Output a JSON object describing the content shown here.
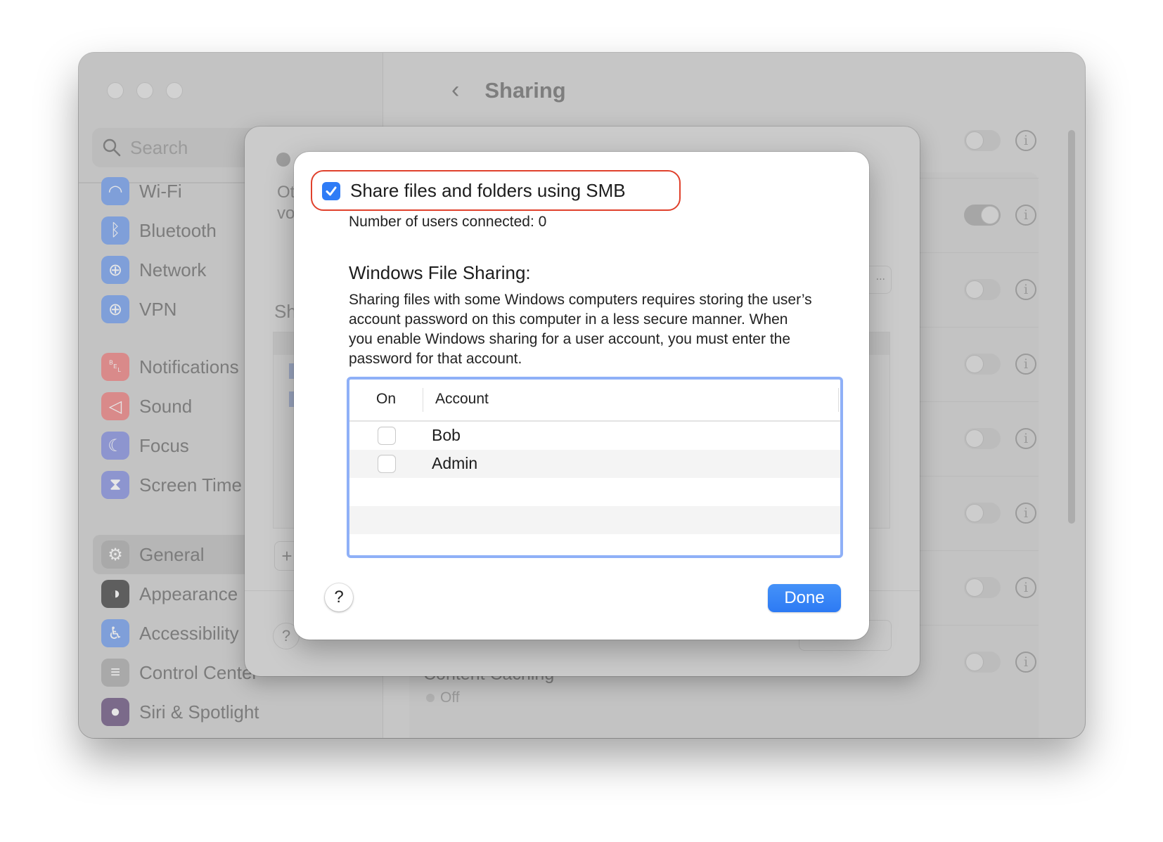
{
  "window": {
    "title": "Sharing",
    "search_placeholder": "Search"
  },
  "sidebar": {
    "items": [
      {
        "label": "Wi-Fi",
        "icon": "wifi-icon",
        "color": "#7f9fd9"
      },
      {
        "label": "Bluetooth",
        "icon": "bluetooth-icon",
        "color": "#7f9fd9"
      },
      {
        "label": "Network",
        "icon": "globe-icon",
        "color": "#7f9fd9"
      },
      {
        "label": "VPN",
        "icon": "vpn-globe-icon",
        "color": "#7f9fd9"
      },
      {
        "label": "Notifications",
        "icon": "bell-icon",
        "color": "#d98a8a"
      },
      {
        "label": "Sound",
        "icon": "speaker-icon",
        "color": "#d98a8a"
      },
      {
        "label": "Focus",
        "icon": "moon-icon",
        "color": "#8d95cf"
      },
      {
        "label": "Screen Time",
        "icon": "hourglass-icon",
        "color": "#8d95cf"
      },
      {
        "label": "General",
        "icon": "gear-icon",
        "color": "#a9a9a9",
        "selected": true
      },
      {
        "label": "Appearance",
        "icon": "appearance-icon",
        "color": "#5e5e5e"
      },
      {
        "label": "Accessibility",
        "icon": "accessibility-icon",
        "color": "#7f9fd9"
      },
      {
        "label": "Control Center",
        "icon": "control-center-icon",
        "color": "#a9a9a9"
      },
      {
        "label": "Siri & Spotlight",
        "icon": "siri-icon",
        "color": "#7b6a8a"
      }
    ]
  },
  "main": {
    "toggles": [
      {
        "on": false
      },
      {
        "on": true
      },
      {
        "on": false
      },
      {
        "on": false
      },
      {
        "on": false
      },
      {
        "on": false
      },
      {
        "on": false
      },
      {
        "on": false
      }
    ],
    "content_caching": {
      "label": "Content Caching",
      "status": "Off"
    }
  },
  "background_sheet": {
    "partial_text_1": "Ot",
    "partial_text_2": "vo",
    "partial_heading": "Sh",
    "options_label": "...",
    "plus_label": "+",
    "help_label": "?"
  },
  "dialog": {
    "smb_checkbox": {
      "label": "Share files and folders using SMB",
      "checked": true
    },
    "users_connected": "Number of users connected: 0",
    "wfs_title": "Windows File Sharing:",
    "wfs_description": "Sharing files with some Windows computers requires storing the user’s account password on this computer in a less secure manner. When you enable Windows sharing for a user account, you must enter the password for that account.",
    "table": {
      "columns": [
        "On",
        "Account"
      ],
      "rows": [
        {
          "on": false,
          "account": "Bob"
        },
        {
          "on": false,
          "account": "Admin"
        }
      ]
    },
    "help_label": "?",
    "done_label": "Done",
    "accent_color": "#2f7cf6",
    "highlight_color": "#e0412c"
  }
}
